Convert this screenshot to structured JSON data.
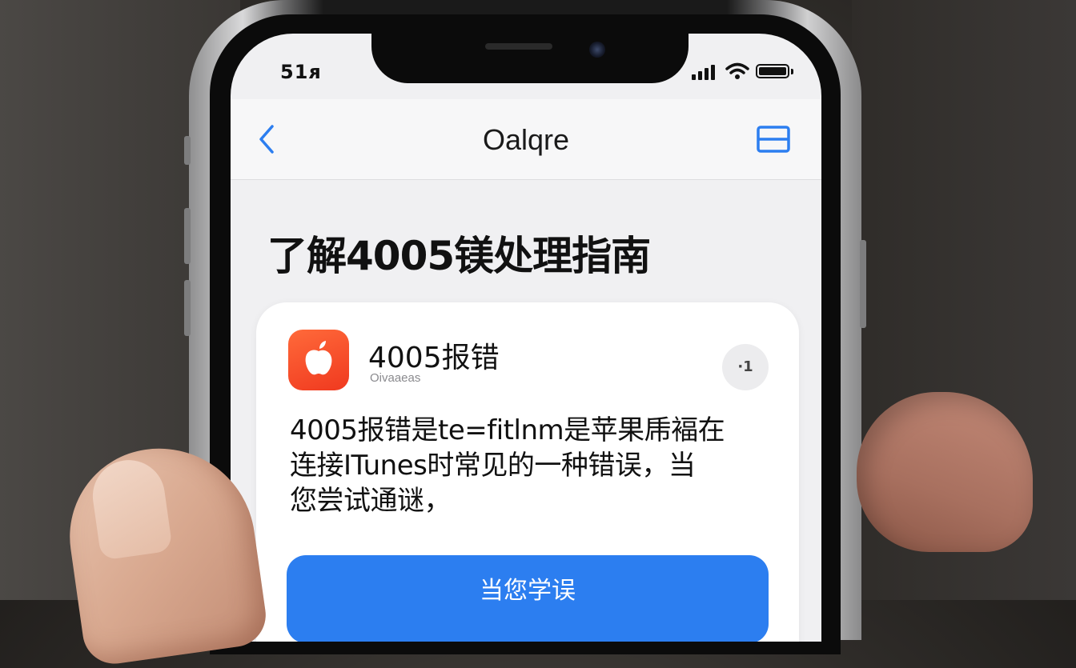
{
  "status_bar": {
    "time": "51ᴙ"
  },
  "nav": {
    "title": "Oalqre"
  },
  "page": {
    "heading": "了解4005镁处理指南"
  },
  "card": {
    "title": "4005报错",
    "subtitle": "Oivaaeas",
    "action_label": "·1",
    "body_line1": "4005报错是te=fitlnm是苹果乕褔在",
    "body_line2": "连接ITunes时常见的一种错误，当",
    "body_line3": "您尝试通谜，",
    "button_label": "当您学误"
  },
  "colors": {
    "accent": "#2c7ef0",
    "app_icon": "#f0391f",
    "nav_icon": "#2c7ef0"
  },
  "icons": [
    "back-chevron-icon",
    "layout-icon",
    "apple-logo-icon",
    "signal-icon",
    "wifi-icon",
    "battery-icon"
  ]
}
